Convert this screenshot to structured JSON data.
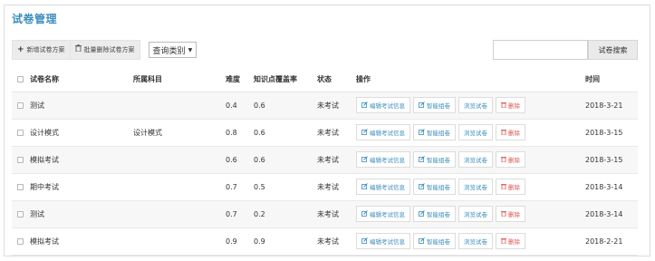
{
  "page": {
    "title": "试卷管理"
  },
  "toolbar": {
    "add_icon": "+",
    "add_label": "新增试卷方案",
    "delete_icon": "trash-icon",
    "delete_label": "批量删除试卷方案",
    "category_select": "查询类别",
    "category_caret": "▼"
  },
  "search": {
    "value": "",
    "button": "试卷搜索"
  },
  "table": {
    "headers": {
      "name": "试卷名称",
      "subject": "所属科目",
      "difficulty": "难度",
      "coverage": "知识点覆盖率",
      "status": "状态",
      "actions": "操作",
      "time": "时间"
    },
    "action_labels": {
      "edit": "编辑考试信息",
      "smart": "智能组卷",
      "browse": "浏览试卷",
      "delete": "删除"
    },
    "rows": [
      {
        "name": "测试",
        "subject": "",
        "difficulty": "0.4",
        "coverage": "0.6",
        "status": "未考试",
        "time": "2018-3-21"
      },
      {
        "name": "设计模式",
        "subject": "设计模式",
        "difficulty": "0.8",
        "coverage": "0.6",
        "status": "未考试",
        "time": "2018-3-15"
      },
      {
        "name": "模拟考试",
        "subject": "",
        "difficulty": "0.6",
        "coverage": "0.6",
        "status": "未考试",
        "time": "2018-3-15"
      },
      {
        "name": "期中考试",
        "subject": "",
        "difficulty": "0.7",
        "coverage": "0.5",
        "status": "未考试",
        "time": "2018-3-14"
      },
      {
        "name": "测试",
        "subject": "",
        "difficulty": "0.7",
        "coverage": "0.2",
        "status": "未考试",
        "time": "2018-3-14"
      },
      {
        "name": "模拟考试",
        "subject": "",
        "difficulty": "0.9",
        "coverage": "0.9",
        "status": "未考试",
        "time": "2018-2-21"
      }
    ]
  },
  "colors": {
    "accent": "#3c8dbc",
    "danger": "#d9534f"
  }
}
